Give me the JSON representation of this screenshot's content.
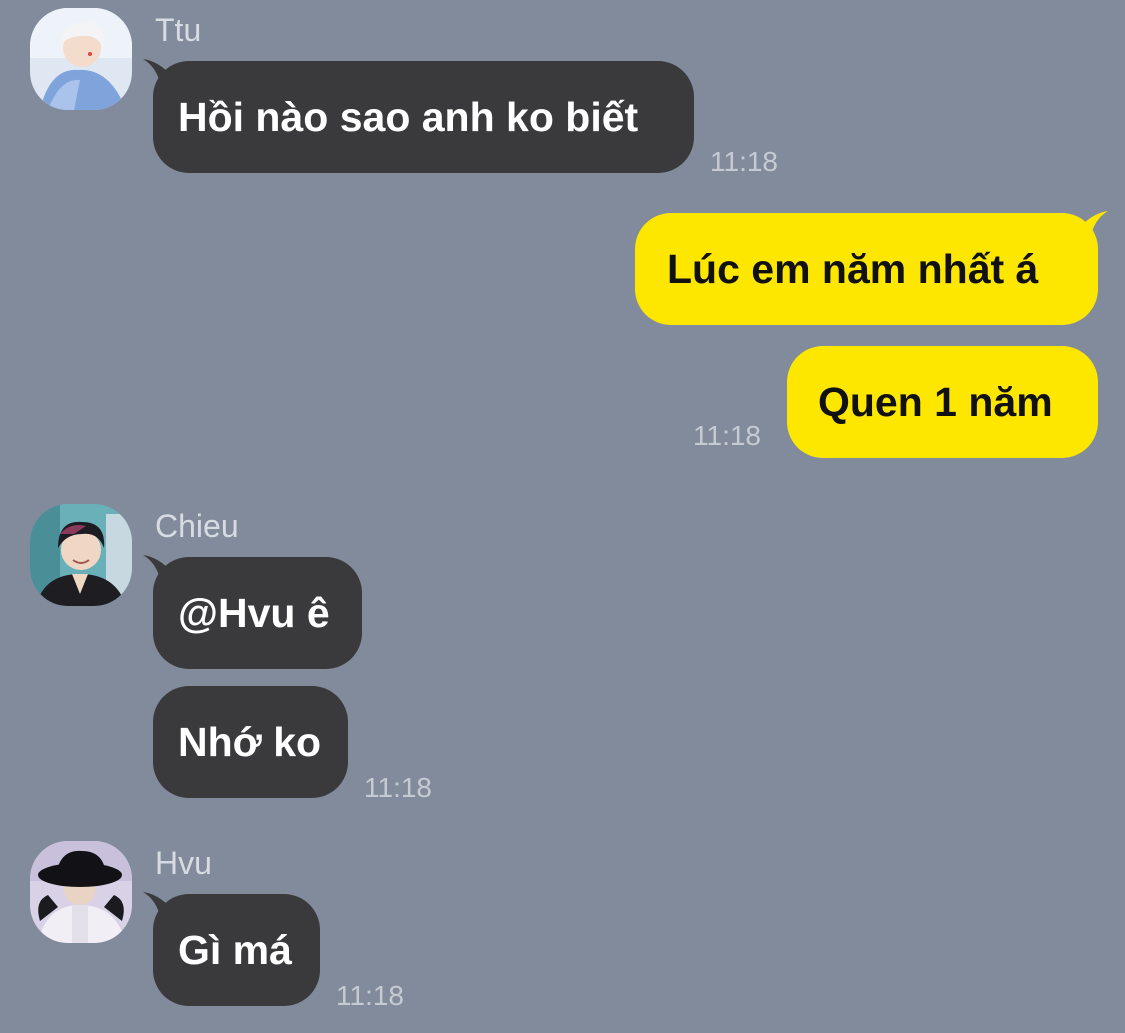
{
  "chat": {
    "group_1": {
      "sender": "Ttu",
      "avatar_icon": "profile-photo-icon",
      "messages": [
        "Hồi nào sao anh ko biết"
      ],
      "time": "11:18"
    },
    "group_2": {
      "sender": "me",
      "messages": [
        "Lúc em năm nhất á",
        "Quen 1 năm"
      ],
      "time": "11:18"
    },
    "group_3": {
      "sender": "Chieu",
      "avatar_icon": "profile-photo-icon",
      "messages": [
        "@Hvu ê",
        "Nhớ ko"
      ],
      "time": "11:18"
    },
    "group_4": {
      "sender": "Hvu",
      "avatar_icon": "profile-photo-icon",
      "messages": [
        "Gì má"
      ],
      "time": "11:18"
    }
  },
  "colors": {
    "background": "#828b9b",
    "incoming_bubble": "#3a3a3c",
    "outgoing_bubble": "#fde700",
    "sender_name": "#d7dbe2",
    "timestamp": "#c6cbd3"
  }
}
